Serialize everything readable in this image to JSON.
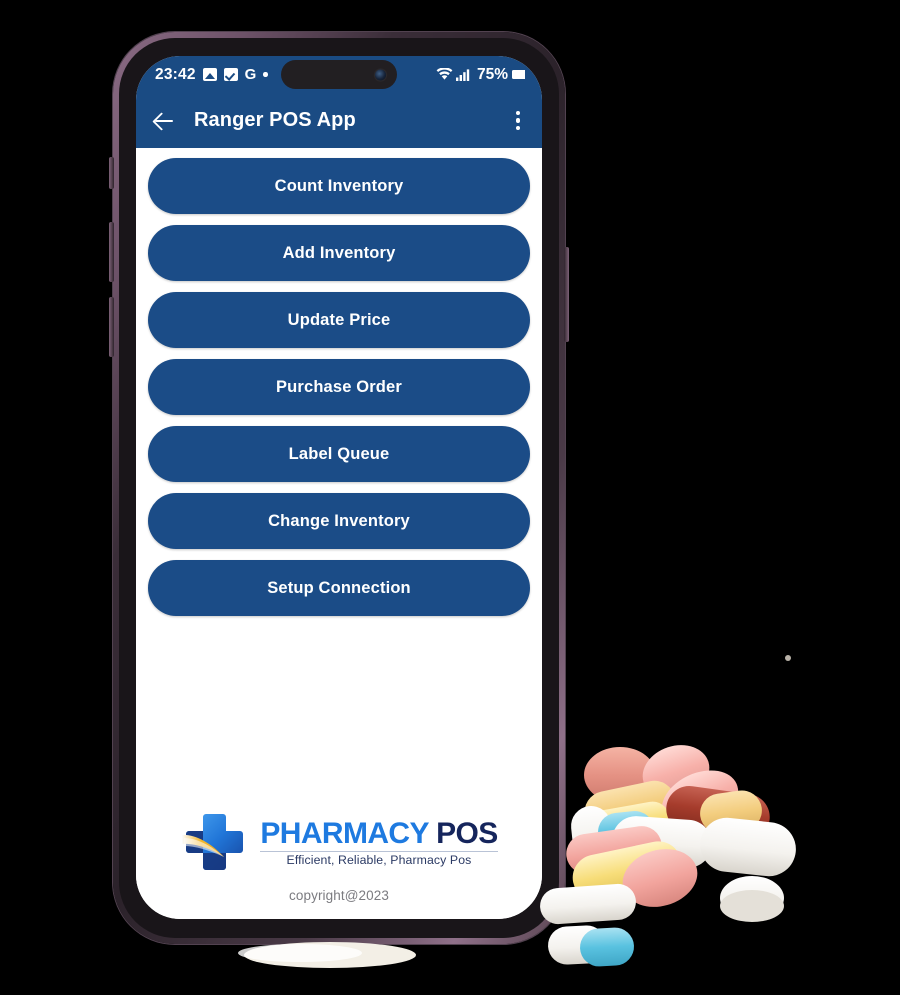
{
  "device": {
    "frame_color": "#6d5268",
    "bezel_color": "#191519"
  },
  "statusbar": {
    "time": "23:42",
    "battery_percent": "75%",
    "icons": [
      "photo-icon",
      "checkbox-icon",
      "google-g-icon",
      "dot-icon",
      "wifi-icon",
      "cellular-signal-icon",
      "battery-icon"
    ]
  },
  "appbar": {
    "back_icon": "back-arrow-icon",
    "title": "Ranger POS App",
    "menu_icon": "overflow-menu-icon",
    "background": "#1a4b83"
  },
  "main": {
    "button_color": "#1b4c87",
    "buttons": [
      {
        "label": "Count Inventory"
      },
      {
        "label": "Add Inventory"
      },
      {
        "label": "Update Price"
      },
      {
        "label": "Purchase Order"
      },
      {
        "label": "Label Queue"
      },
      {
        "label": "Change Inventory"
      },
      {
        "label": "Setup Connection"
      }
    ]
  },
  "footer": {
    "logo_icon": "pharmacy-cross-logo-icon",
    "brand_primary": "PHARMACY",
    "brand_secondary": "POS",
    "tagline": "Efficient, Reliable, Pharmacy Pos",
    "copyright": "copyright@2023",
    "brand_primary_color": "#1e7ae0",
    "brand_secondary_color": "#15255c"
  },
  "decor": {
    "pills_image": "pills-pile-photo"
  }
}
